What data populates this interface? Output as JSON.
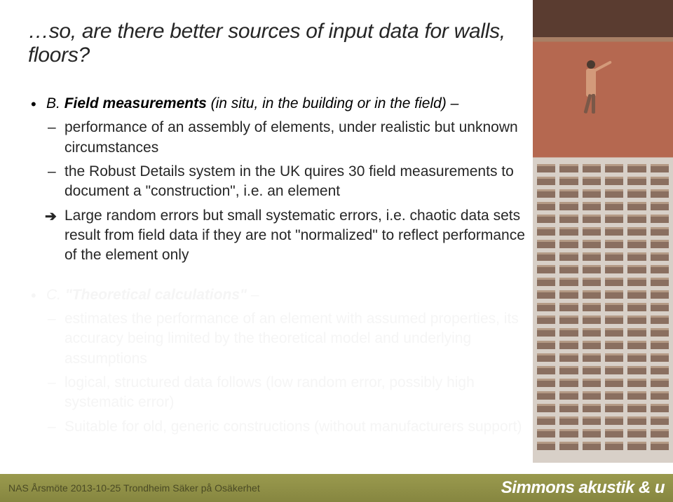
{
  "title": "…so, are there better sources of input data for walls, floors?",
  "bulletB": {
    "marker": "B.",
    "lead_emph": "Field measurements",
    "lead_rest": " (in situ, in the building or in the field) –",
    "subs": [
      "performance of an assembly of elements, under realistic but unknown circumstances",
      "the Robust Details system in the UK quires 30 field measurements to document a \"construction\", i.e. an element",
      "Large random errors but small systematic errors, i.e. chaotic data sets result from field data if they are not \"normalized\" to reflect performance of the element only"
    ],
    "arrow": "➔"
  },
  "bulletC": {
    "marker": "C.",
    "lead_emph": "\"Theoretical calculations\"",
    "lead_rest": " –",
    "subs": [
      "estimates the performance of an element with assumed properties, its accuracy being limited by the theoretical model and underlying assumptions",
      "logical, structured data follows (low random error, possibly high systematic error)",
      "Suitable for old, generic constructions (without manufacturers support)"
    ]
  },
  "footer": {
    "left": "NAS Årsmöte 2013-10-25 Trondheim Säker på Osäkerhet",
    "right": "Simmons akustik & u"
  }
}
